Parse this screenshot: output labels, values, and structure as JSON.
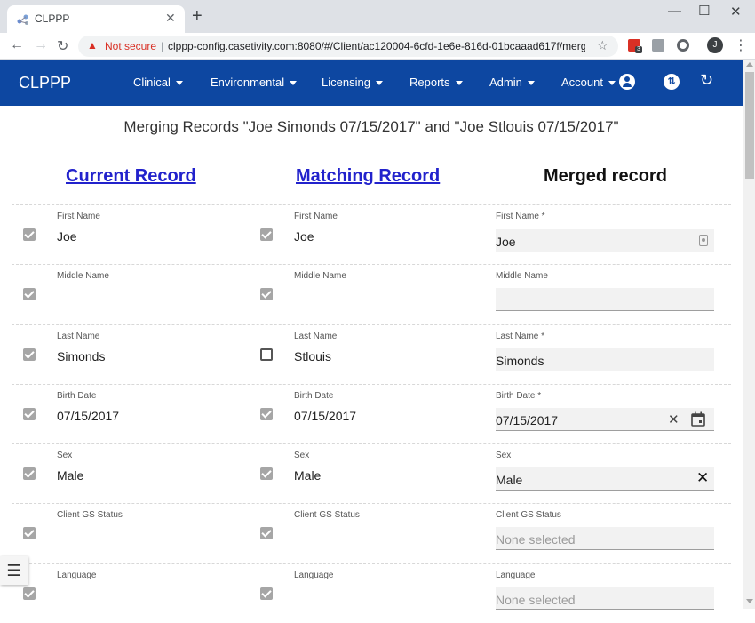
{
  "browser": {
    "tab_title": "CLPPP",
    "not_secure": "Not secure",
    "separator": "|",
    "url": "clppp-config.casetivity.com:8080/#/Client/ac120004-6cfd-1e6e-816d-01bcaaad617f/merg...",
    "ext_badge": "3",
    "avatar_letter": "J"
  },
  "app": {
    "brand": "CLPPP",
    "menus": [
      "Clinical",
      "Environmental",
      "Licensing",
      "Reports",
      "Admin",
      "Account"
    ]
  },
  "page": {
    "title": "Merging Records \"Joe Simonds 07/15/2017\" and \"Joe Stlouis 07/15/2017\"",
    "current_heading": "Current Record",
    "matching_heading": "Matching Record",
    "merged_heading": "Merged record"
  },
  "rows": [
    {
      "label": "First Name",
      "current": "Joe",
      "current_checked": true,
      "matching": "Joe",
      "matching_checked": true,
      "merged_label": "First Name *",
      "merged": "Joe"
    },
    {
      "label": "Middle Name",
      "current": "",
      "current_checked": true,
      "matching": "",
      "matching_checked": true,
      "merged_label": "Middle Name",
      "merged": ""
    },
    {
      "label": "Last Name",
      "current": "Simonds",
      "current_checked": true,
      "matching": "Stlouis",
      "matching_checked": false,
      "merged_label": "Last Name *",
      "merged": "Simonds"
    },
    {
      "label": "Birth Date",
      "current": "07/15/2017",
      "current_checked": true,
      "matching": "07/15/2017",
      "matching_checked": true,
      "merged_label": "Birth Date *",
      "merged": "07/15/2017"
    },
    {
      "label": "Sex",
      "current": "Male",
      "current_checked": true,
      "matching": "Male",
      "matching_checked": true,
      "merged_label": "Sex",
      "merged": "Male"
    },
    {
      "label": "Client GS Status",
      "current": "",
      "current_checked": true,
      "matching": "",
      "matching_checked": true,
      "merged_label": "Client GS Status",
      "merged_placeholder": "None selected"
    },
    {
      "label": "Language",
      "current": "",
      "current_checked": true,
      "matching": "",
      "matching_checked": true,
      "merged_label": "Language",
      "merged_placeholder": "None selected"
    }
  ],
  "icons": {
    "menu_caret": "caret-down-icon",
    "account": "account-circle-icon",
    "swap": "swap-icon",
    "refresh": "refresh-icon",
    "clear": "close-icon",
    "calendar": "calendar-icon",
    "fab": "format-line-spacing-icon"
  }
}
